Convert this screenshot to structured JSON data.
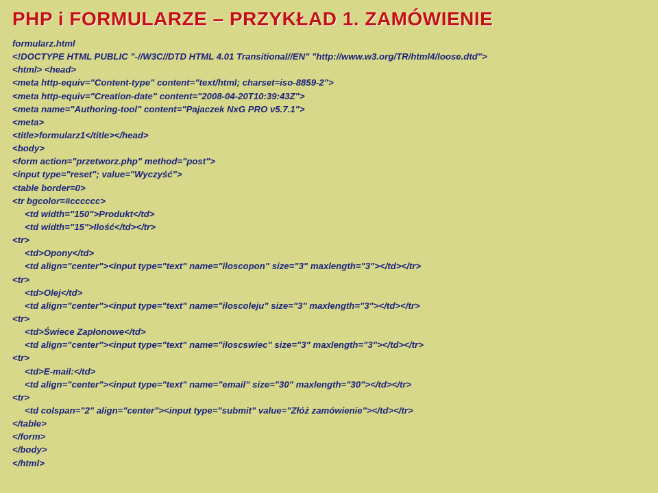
{
  "title": "PHP i FORMULARZE – PRZYKŁAD 1. ZAMÓWIENIE",
  "lines": {
    "l0": "formularz.html",
    "l1": "<!DOCTYPE HTML PUBLIC \"-//W3C//DTD HTML 4.01 Transitional//EN\" \"http://www.w3.org/TR/html4/loose.dtd\">",
    "l2": "<html> <head>",
    "l3": "<meta http-equiv=\"Content-type\" content=\"text/html; charset=iso-8859-2\">",
    "l4": "<meta http-equiv=\"Creation-date\" content=\"2008-04-20T10:39:43Z\">",
    "l5": "<meta name=\"Authoring-tool\" content=\"Pajaczek NxG PRO v5.7.1\">",
    "l6": "<meta>",
    "l7": "<title>formularz1</title></head>",
    "l8": "<body>",
    "l9": "<form action=\"przetworz.php\" method=\"post\">",
    "l10": "<input type=\"reset\"; value=\"Wyczyść\">",
    "l11": "<table border=0>",
    "l12": "<tr bgcolor=#cccccc>",
    "l13": "<td width=\"150\">Produkt</td>",
    "l14": "<td width=\"15\">Ilość</td></tr>",
    "l15": "<tr>",
    "l16": "<td>Opony</td>",
    "l17": "<td align=\"center\"><input type=\"text\" name=\"iloscopon\" size=\"3\" maxlength=\"3\"></td></tr>",
    "l18": "<tr>",
    "l19": "<td>Olej</td>",
    "l20": "<td align=\"center\"><input type=\"text\" name=\"iloscoleju\" size=\"3\" maxlength=\"3\"></td></tr>",
    "l21": "<tr>",
    "l22": "<td>Świece Zapłonowe</td>",
    "l23": "<td align=\"center\"><input type=\"text\" name=\"iloscswiec\" size=\"3\" maxlength=\"3\"></td></tr>",
    "l24": "<tr>",
    "l25": "<td>E-mail:</td>",
    "l26": "<td align=\"center\"><input type=\"text\" name=\"email\" size=\"30\" maxlength=\"30\"></td></tr>",
    "l27": "<tr>",
    "l28": "<td colspan=\"2\" align=\"center\"><input type=\"submit\" value=\"Złóż zamówienie\"></td></tr>",
    "l29": "</table>",
    "l30": "</form>",
    "l31": "</body>",
    "l32": "</html>"
  }
}
